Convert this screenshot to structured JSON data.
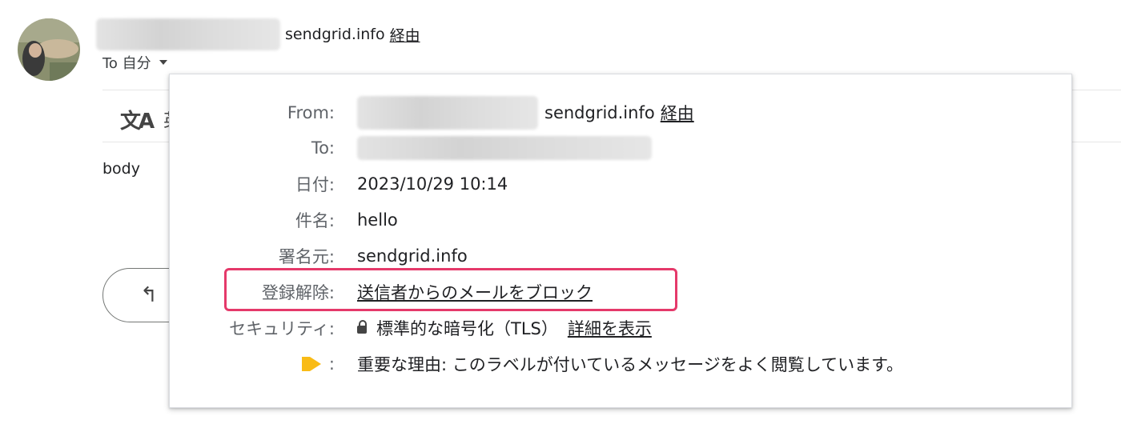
{
  "message": {
    "sender_domain": "sendgrid.info",
    "via_label": "経由",
    "to_line": "To 自分",
    "translate_label_partial": "英",
    "body_text": "body",
    "reply_icon": "reply-icon"
  },
  "details": {
    "from": {
      "label": "From:",
      "domain": "sendgrid.info",
      "via_label": "経由"
    },
    "to": {
      "label": "To:"
    },
    "date": {
      "label": "日付:",
      "value": "2023/10/29 10:14"
    },
    "subject": {
      "label": "件名:",
      "value": "hello"
    },
    "signed_by": {
      "label": "署名元:",
      "value": "sendgrid.info"
    },
    "unsubscribe": {
      "label": "登録解除:",
      "link": "送信者からのメールをブロック"
    },
    "security": {
      "label": "セキュリティ:",
      "value": "標準的な暗号化（TLS）",
      "link": "詳細を表示",
      "icon": "lock-icon"
    },
    "importance": {
      "label_suffix": ":",
      "value": "重要な理由: このラベルが付いているメッセージをよく閲覧しています。",
      "icon": "importance-marker-icon",
      "color": "#f9bb16"
    }
  },
  "highlight": {
    "color": "#e5396a"
  }
}
